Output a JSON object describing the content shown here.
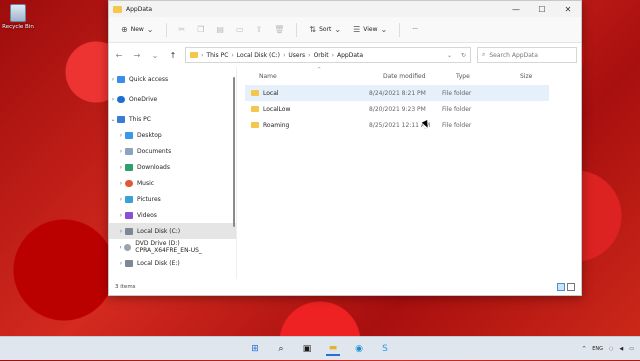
{
  "desktop": {
    "recycle_bin_label": "Recycle Bin"
  },
  "window": {
    "title": "AppData",
    "min": "—",
    "max": "☐",
    "close": "✕"
  },
  "cmdbar": {
    "new_label": "New",
    "sort_label": "Sort",
    "view_label": "View",
    "more_label": "···"
  },
  "address": {
    "path": [
      "This PC",
      "Local Disk (C:)",
      "Users",
      "Orbit",
      "AppData"
    ],
    "search_placeholder": "Search AppData"
  },
  "sidebar": {
    "quick_access": "Quick access",
    "onedrive": "OneDrive",
    "this_pc": "This PC",
    "desktop": "Desktop",
    "documents": "Documents",
    "downloads": "Downloads",
    "music": "Music",
    "pictures": "Pictures",
    "videos": "Videos",
    "local_disk": "Local Disk (C:)",
    "dvd": "DVD Drive (D:) CPRA_X64FRE_EN-US_",
    "local_disk_e": "Local Disk (E:)"
  },
  "columns": {
    "name": "Name",
    "date": "Date modified",
    "type": "Type",
    "size": "Size"
  },
  "files": [
    {
      "name": "Local",
      "date": "8/24/2021 8:21 PM",
      "type": "File folder"
    },
    {
      "name": "LocalLow",
      "date": "8/20/2021 9:23 PM",
      "type": "File folder"
    },
    {
      "name": "Roaming",
      "date": "8/25/2021 12:11 AM",
      "type": "File folder"
    }
  ],
  "status": {
    "count": "3 items"
  },
  "tray": {
    "lang": "ENG"
  }
}
